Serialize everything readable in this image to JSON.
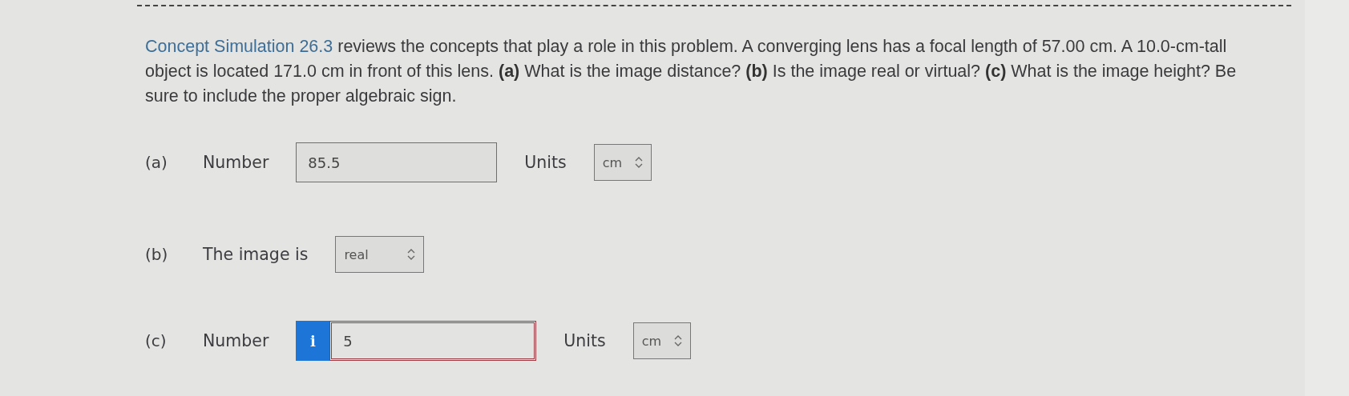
{
  "question": {
    "link": "Concept Simulation 26.3",
    "text": " reviews the concepts that play a role in this problem. A converging lens has a focal length of 57.00 cm. A 10.0-cm-tall object is located 171.0 cm in front of this lens. **(a)** What is the image distance? **(b)** Is the image real or virtual? **(c)** What is the image height? Be sure to include the proper algebraic sign."
  },
  "parts": [
    {
      "kind": "number",
      "tag": "(a)",
      "label": "Number",
      "value": "85.5",
      "error": false,
      "units_label": "Units",
      "units": "cm"
    },
    {
      "kind": "choice",
      "tag": "(b)",
      "label": "The image is",
      "choice": "real"
    },
    {
      "kind": "number",
      "tag": "(c)",
      "label": "Number",
      "value": "5",
      "error": true,
      "info": "i",
      "units_label": "Units",
      "units": "cm"
    }
  ]
}
